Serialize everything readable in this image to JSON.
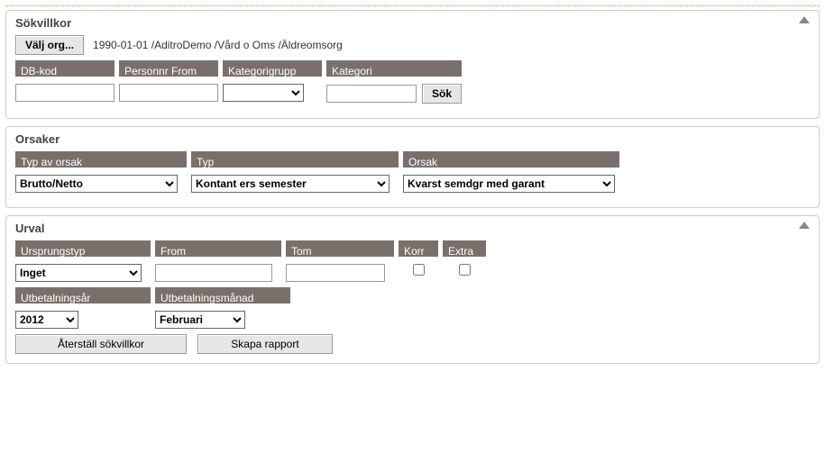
{
  "sokvillkor": {
    "title": "Sökvillkor",
    "valj_org_label": "Välj org...",
    "org_text": "1990-01-01 /AditroDemo /Vård o Oms /Äldreomsorg",
    "dbkod": {
      "header": "DB-kod",
      "value": ""
    },
    "personnr": {
      "header": "Personnr From",
      "value": ""
    },
    "kategorigrupp": {
      "header": "Kategorigrupp",
      "value": ""
    },
    "kategori": {
      "header": "Kategori",
      "value": ""
    },
    "sok_label": "Sök"
  },
  "orsaker": {
    "title": "Orsaker",
    "typ_av_orsak": {
      "header": "Typ av orsak",
      "value": "Brutto/Netto"
    },
    "typ": {
      "header": "Typ",
      "value": "Kontant ers semester"
    },
    "orsak": {
      "header": "Orsak",
      "value": "Kvarst semdgr med garant"
    }
  },
  "urval": {
    "title": "Urval",
    "ursprungstyp": {
      "header": "Ursprungstyp",
      "value": "Inget"
    },
    "from": {
      "header": "From",
      "value": ""
    },
    "tom": {
      "header": "Tom",
      "value": ""
    },
    "korr": {
      "header": "Korr"
    },
    "extra": {
      "header": "Extra"
    },
    "utbetalningsar": {
      "header": "Utbetalningsår",
      "value": "2012"
    },
    "utbetalningsmanad": {
      "header": "Utbetalningsmånad",
      "value": "Februari"
    },
    "aterstall_label": "Återställ sökvillkor",
    "skapa_label": "Skapa rapport"
  }
}
